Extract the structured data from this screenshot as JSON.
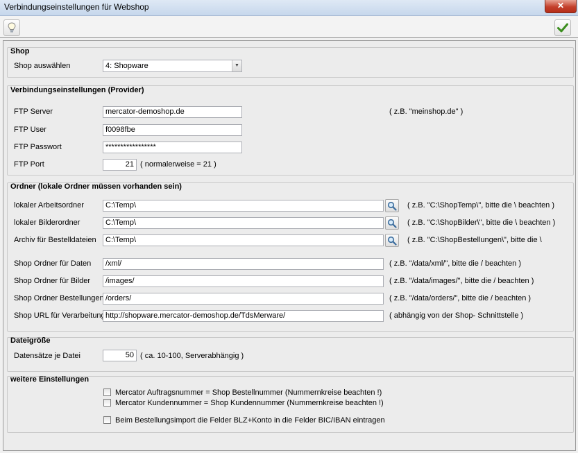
{
  "window": {
    "title": "Verbindungseinstellungen für Webshop",
    "close_glyph": "✕"
  },
  "toolbar": {
    "hint_icon": "lightbulb-icon",
    "confirm_icon": "checkmark-icon"
  },
  "shop": {
    "title": "Shop",
    "select_label": "Shop auswählen",
    "select_value": "4: Shopware"
  },
  "connection": {
    "title": "Verbindungseinstellungen (Provider)",
    "server_label": "FTP Server",
    "server_value": "mercator-demoshop.de",
    "server_hint": "( z.B. \"meinshop.de\" )",
    "user_label": "FTP User",
    "user_value": "f0098fbe",
    "password_label": "FTP Passwort",
    "password_value": "*****************",
    "port_label": "FTP Port",
    "port_value": "21",
    "port_hint": "( normalerweise = 21 )"
  },
  "folders": {
    "title": "Ordner (lokale Ordner müssen vorhanden sein)",
    "work_label": "lokaler Arbeitsordner",
    "work_value": "C:\\Temp\\",
    "work_hint": "( z.B. \"C:\\ShopTemp\\\", bitte die \\ beachten )",
    "images_label": "lokaler Bilderordner",
    "images_value": "C:\\Temp\\",
    "images_hint": "( z.B. \"C:\\ShopBilder\\\", bitte die \\ beachten )",
    "archive_label": "Archiv für Bestelldateien",
    "archive_value": "C:\\Temp\\",
    "archive_hint": "( z.B. \"C:\\ShopBestellungen\\\", bitte die \\",
    "shop_data_label": "Shop Ordner für Daten",
    "shop_data_value": "/xml/",
    "shop_data_hint": "( z.B. \"/data/xml/\", bitte die / beachten )",
    "shop_images_label": "Shop Ordner für Bilder",
    "shop_images_value": "/images/",
    "shop_images_hint": "( z.B. \"/data/images/\", bitte die / beachten )",
    "shop_orders_label": "Shop Ordner Bestellungen",
    "shop_orders_value": "/orders/",
    "shop_orders_hint": "( z.B. \"/data/orders/\", bitte die / beachten )",
    "shop_url_label": "Shop URL für Verarbeitung",
    "shop_url_value": "http://shopware.mercator-demoshop.de/TdsMerware/",
    "shop_url_hint": "( abhängig von der Shop- Schnittstelle )"
  },
  "filesize": {
    "title": "Dateigröße",
    "records_label": "Datensätze je Datei",
    "records_value": "50",
    "records_hint": "( ca. 10-100, Serverabhängig )"
  },
  "more": {
    "title": "weitere Einstellungen",
    "opt1_label": "Mercator Auftragsnummer = Shop Bestellnummer (Nummernkreise beachten !)",
    "opt1_checked": false,
    "opt2_label": "Mercator Kundennummer = Shop Kundennummer (Nummernkreise beachten !)",
    "opt2_checked": false,
    "opt3_label": "Beim Bestellungsimport die Felder BLZ+Konto in die Felder BIC/IBAN eintragen",
    "opt3_checked": false
  }
}
